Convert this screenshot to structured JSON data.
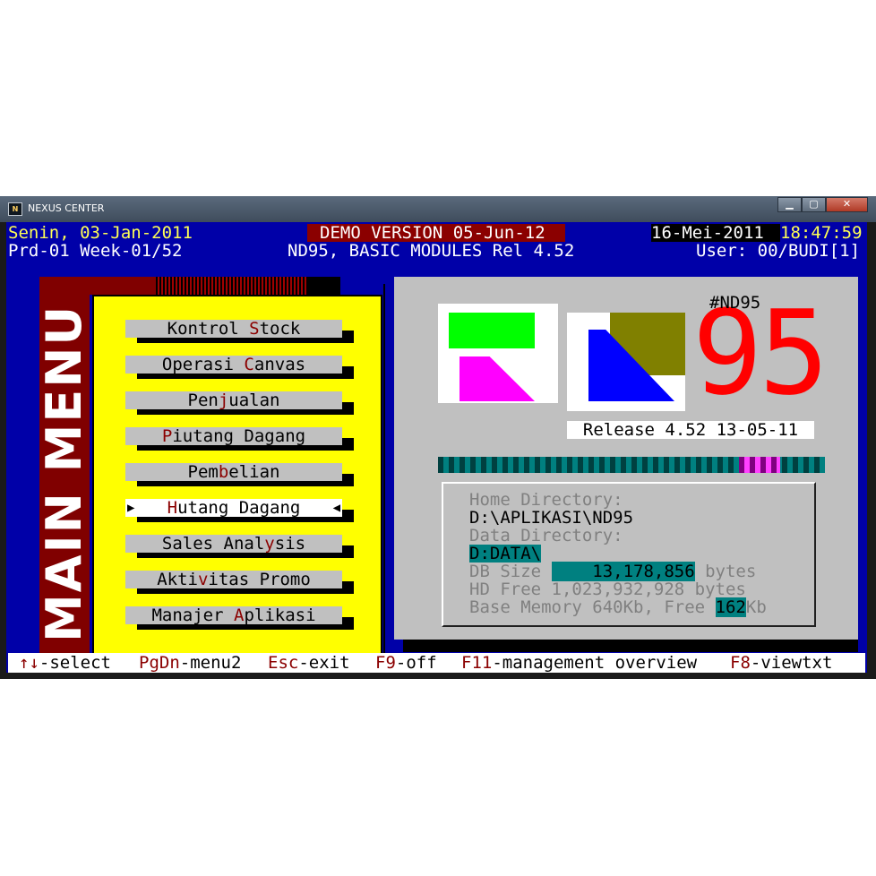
{
  "window": {
    "title": "NEXUS CENTER",
    "app_icon_glyph": "N",
    "controls": {
      "minimize": "▁",
      "maximize": "▢",
      "close": "✕"
    }
  },
  "header": {
    "date_left": "Senin, 03-Jan-2011",
    "period": "Prd-01 Week-01/52",
    "demo": "DEMO VERSION 05-Jun-12",
    "product": "ND95, BASIC MODULES Rel 4.52",
    "date_right": "16-Mei-2011",
    "time": "18:47:59",
    "user": "User: 00/BUDI[1]"
  },
  "menu": {
    "vertical_title": "MAIN MENU",
    "slash": "/",
    "items": [
      {
        "pre": "Kontrol ",
        "hot": "S",
        "post": "tock"
      },
      {
        "pre": "Operasi ",
        "hot": "C",
        "post": "anvas"
      },
      {
        "pre": "Pen",
        "hot": "j",
        "post": "ualan"
      },
      {
        "pre": "",
        "hot": "P",
        "post": "iutang Dagang"
      },
      {
        "pre": "Pem",
        "hot": "b",
        "post": "elian"
      },
      {
        "pre": "",
        "hot": "H",
        "post": "utang Dagang",
        "selected": true,
        "arrow_left": "▶",
        "arrow_right": "◀"
      },
      {
        "pre": "Sales Anal",
        "hot": "y",
        "post": "sis"
      },
      {
        "pre": "Akti",
        "hot": "v",
        "post": "itas Promo"
      },
      {
        "pre": "Manajer ",
        "hot": "A",
        "post": "plikasi"
      }
    ]
  },
  "logo": {
    "tag": "#ND95",
    "digits": "95",
    "release": "Release 4.52 13-05-11"
  },
  "info": {
    "home_label": "Home Directory:",
    "home_value": "D:\\APLIKASI\\ND95",
    "data_label": "Data Directory:",
    "data_value": "D:DATA\\",
    "db_label": "DB Size ",
    "db_value": "    13,178,856",
    "db_unit": " bytes",
    "hd_line": "HD Free 1,023,932,928 bytes",
    "mem_pre": "Base Memory 640Kb, Free ",
    "mem_value": "162",
    "mem_unit": "Kb"
  },
  "statusbar": [
    {
      "key": "↑↓",
      "label": "-select"
    },
    {
      "key": "PgDn",
      "label": "-menu2"
    },
    {
      "key": "Esc",
      "label": "-exit"
    },
    {
      "key": "F9",
      "label": "-off"
    },
    {
      "key": "F11",
      "label": "-management overview"
    },
    {
      "key": "F8",
      "label": "-viewtxt"
    }
  ],
  "colors": {
    "console_bg": "#0000a8",
    "panel_bg": "#c0c0c0",
    "menu_bg": "#ffff00",
    "menu_title_bg": "#800000",
    "hotkey": "#8b0000",
    "logo_red": "#ff0000"
  }
}
